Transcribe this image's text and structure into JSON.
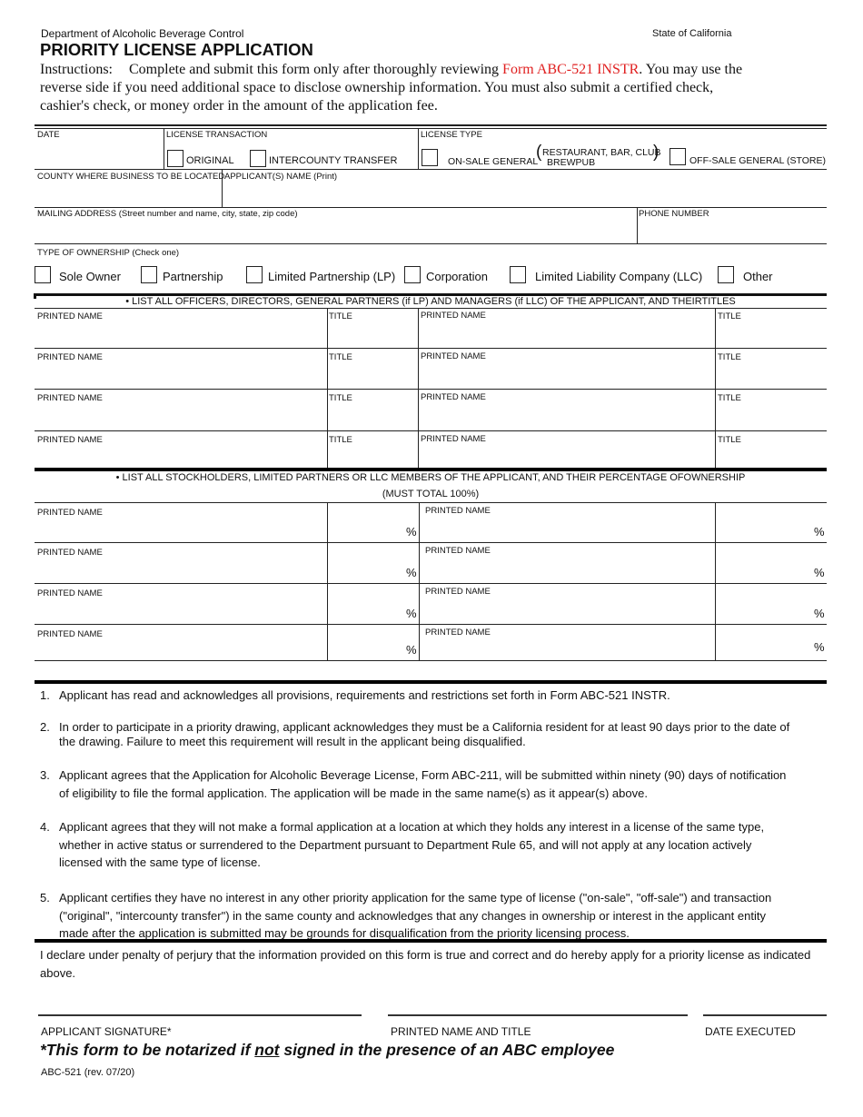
{
  "header": {
    "department": "Department of Alcoholic Beverage Control",
    "state": "State of California",
    "title": "PRIORITY LICENSE APPLICATION",
    "instructions_label": "Instructions:",
    "instructions_pre": "Complete and submit this form only after thoroughly reviewing",
    "instructions_link": "Form ABC-521 INSTR",
    "instructions_line1_post": ".  You may use the",
    "instructions_line2": "reverse side if you need additional space to disclose ownership information.  You must also submit a certified check,",
    "instructions_line3": "cashier's check, or money order in the amount of the application fee.",
    "link_color": "#e02020"
  },
  "section1": {
    "date_label": "DATE",
    "license_transaction_label": "LICENSE TRANSACTION",
    "transaction_options": [
      "ORIGINAL",
      "INTERCOUNTY TRANSFER"
    ],
    "license_type_label": "LICENSE TYPE",
    "on_sale_label": "ON-SALE GENERAL",
    "on_sale_note_line1": "RESTAURANT, BAR, CLUB",
    "on_sale_note_line2": "BREWPUB",
    "off_sale_label": "OFF-SALE GENERAL (STORE)",
    "county_label": "COUNTY WHERE BUSINESS TO BE LOCATED",
    "applicant_name_label": "APPLICANT(S) NAME (Print)",
    "mailing_address_label": "MAILING ADDRESS (Street number and name, city, state, zip code)",
    "phone_label": "PHONE NUMBER",
    "ownership_label": "TYPE OF OWNERSHIP (Check one)",
    "ownership_options": [
      "Sole Owner",
      "Partnership",
      "Limited Partnership (LP)",
      "Corporation",
      "Limited Liability Company (LLC)",
      "Other"
    ]
  },
  "officers": {
    "heading": "• LIST ALL OFFICERS, DIRECTORS, GENERAL PARTNERS (if LP) AND MANAGERS (if LLC) OF THE APPLICANT, AND THEIRTITLES",
    "name_label": "PRINTED NAME",
    "title_label": "TITLE",
    "row_count": 4
  },
  "stockholders": {
    "heading_line1": "• LIST ALL STOCKHOLDERS, LIMITED PARTNERS OR LLC MEMBERS OF THE APPLICANT, AND THEIR PERCENTAGE OFOWNERSHIP",
    "heading_line2": "(MUST TOTAL 100%)",
    "name_label": "PRINTED NAME",
    "percent_symbol": "%",
    "row_count": 4
  },
  "statements": [
    {
      "num": "1.",
      "text": "Applicant has read and acknowledges all provisions, requirements and restrictions set forth in Form ABC-521 INSTR."
    },
    {
      "num": "2.",
      "text": "In order to participate in a priority drawing, applicant acknowledges they must be a California resident for at least 90 days prior to the date of the drawing.  Failure to meet this requirement will result in the applicant being disqualified."
    },
    {
      "num": "3.",
      "text": "Applicant agrees that the Application for Alcoholic Beverage License, Form ABC-211, will be submitted within ninety (90) days of notification of eligibility to file the formal application. The application will be made in the same name(s) as it appear(s) above."
    },
    {
      "num": "4.",
      "text": "Applicant agrees that they will not make a formal application at a location at which they holds any interest in a license of the same type, whether in active status or surrendered to the Department pursuant to Department Rule 65, and will not apply at any location actively licensed with the same type of license."
    },
    {
      "num": "5.",
      "text": "Applicant certifies they have no interest in any other priority application for the same type of license (\"on-sale\", \"off-sale\") and transaction (\"original\", \"intercounty transfer\") in the same county and acknowledges that any changes in ownership or interest in the applicant entity made after the application is submitted may be grounds for disqualification from the priority licensing process."
    }
  ],
  "declaration": "I declare under penalty of perjury that the information provided on this form is true and correct and do hereby apply for a priority license as indicated above.",
  "signature": {
    "applicant_signature_label": "APPLICANT SIGNATURE*",
    "printed_name_title_label": "PRINTED NAME AND TITLE",
    "date_executed_label": "DATE EXECUTED",
    "notary_pre": "*This form to be notarized if ",
    "notary_underlined": "not",
    "notary_post": " signed in the presence of an ABC employee"
  },
  "footer": {
    "form_id": "ABC-521 (rev. 07/20)"
  }
}
